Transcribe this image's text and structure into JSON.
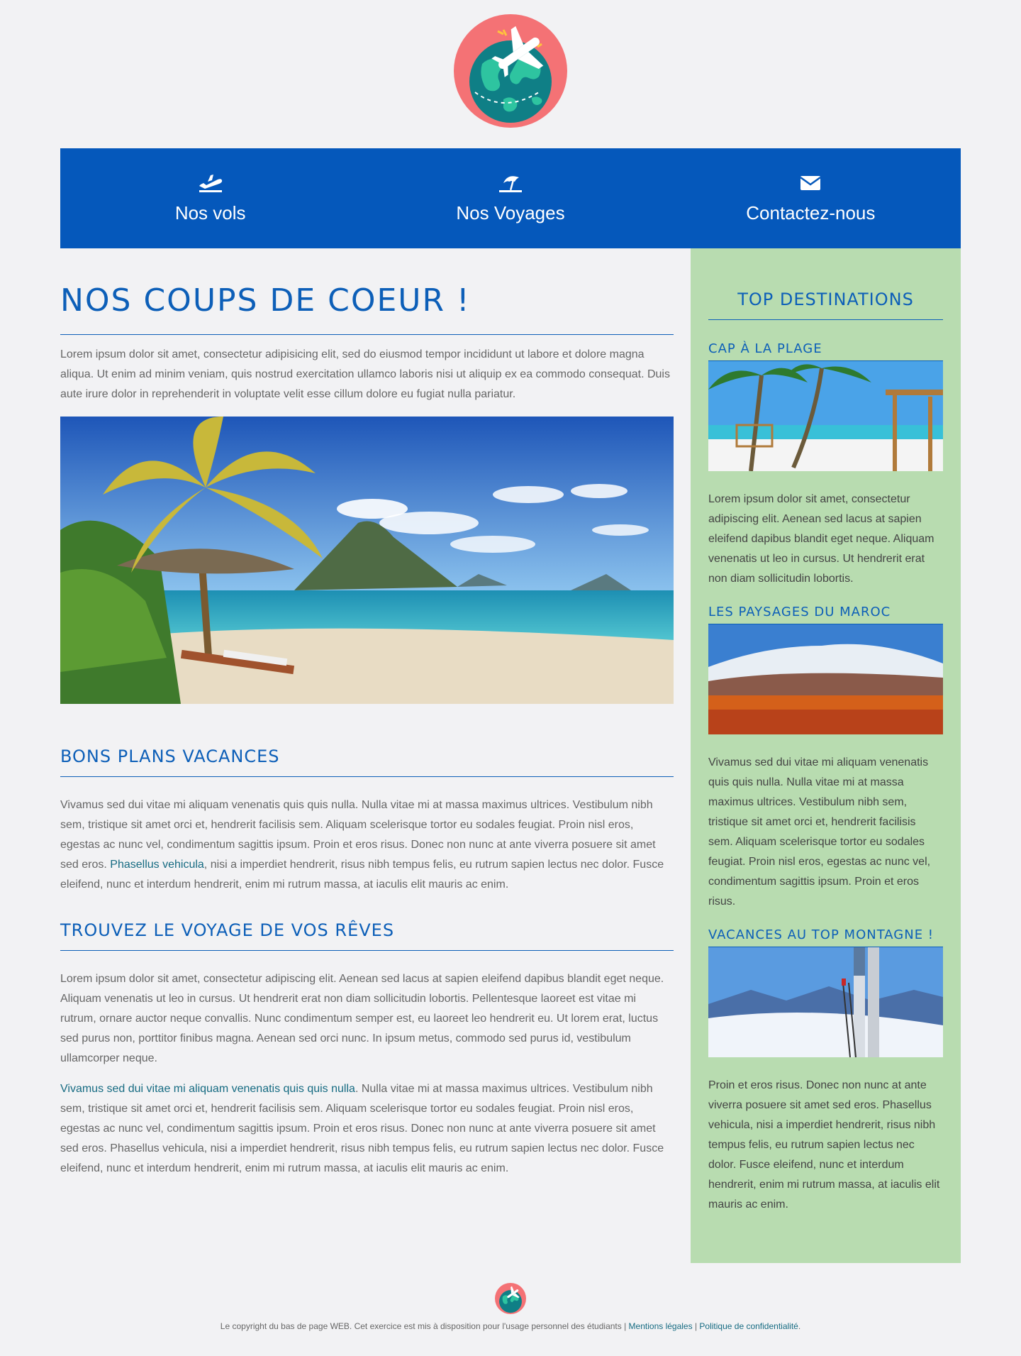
{
  "brand": {
    "logo_icon": "globe-airplane-logo"
  },
  "nav": {
    "items": [
      {
        "label": "Nos vols",
        "icon": "plane-departure-icon"
      },
      {
        "label": "Nos Voyages",
        "icon": "beach-umbrella-icon"
      },
      {
        "label": "Contactez-nous",
        "icon": "envelope-icon"
      }
    ]
  },
  "main": {
    "title": "Nos coups de coeur !",
    "intro": "Lorem ipsum dolor sit amet, consectetur adipisicing elit, sed do eiusmod tempor incididunt ut labore et dolore magna aliqua. Ut enim ad minim veniam, quis nostrud exercitation ullamco laboris nisi ut aliquip ex ea commodo consequat. Duis aute irure dolor in reprehenderit in voluptate velit esse cillum dolore eu fugiat nulla pariatur.",
    "section1": {
      "title": "Bons plans vacances",
      "text_before": "Vivamus sed dui vitae mi aliquam venenatis quis quis nulla. Nulla vitae mi at massa maximus ultrices. Vestibulum nibh sem, tristique sit amet orci et, hendrerit facilisis sem. Aliquam scelerisque tortor eu sodales feugiat. Proin nisl eros, egestas ac nunc vel, condimentum sagittis ipsum. Proin et eros risus. Donec non nunc at ante viverra posuere sit amet sed eros. ",
      "link": "Phasellus vehicula",
      "text_after": ", nisi a imperdiet hendrerit, risus nibh tempus felis, eu rutrum sapien lectus nec dolor. Fusce eleifend, nunc et interdum hendrerit, enim mi rutrum massa, at iaculis elit mauris ac enim."
    },
    "section2": {
      "title": "Trouvez le voyage de vos rêves",
      "para1": "Lorem ipsum dolor sit amet, consectetur adipiscing elit. Aenean sed lacus at sapien eleifend dapibus blandit eget neque. Aliquam venenatis ut leo in cursus. Ut hendrerit erat non diam sollicitudin lobortis. Pellentesque laoreet est vitae mi rutrum, ornare auctor neque convallis. Nunc condimentum semper est, eu laoreet leo hendrerit eu. Ut lorem erat, luctus sed purus non, porttitor finibus magna. Aenean sed orci nunc. In ipsum metus, commodo sed purus id, vestibulum ullamcorper neque.",
      "para2_link": "Vivamus sed dui vitae mi aliquam venenatis quis quis nulla",
      "para2_text": ". Nulla vitae mi at massa maximus ultrices. Vestibulum nibh sem, tristique sit amet orci et, hendrerit facilisis sem. Aliquam scelerisque tortor eu sodales feugiat. Proin nisl eros, egestas ac nunc vel, condimentum sagittis ipsum. Proin et eros risus. Donec non nunc at ante viverra posuere sit amet sed eros. Phasellus vehicula, nisi a imperdiet hendrerit, risus nibh tempus felis, eu rutrum sapien lectus nec dolor. Fusce eleifend, nunc et interdum hendrerit, enim mi rutrum massa, at iaculis elit mauris ac enim."
    }
  },
  "sidebar": {
    "title": "Top destinations",
    "items": [
      {
        "title": "Cap à la plage",
        "text": "Lorem ipsum dolor sit amet, consectetur adipiscing elit. Aenean sed lacus at sapien eleifend dapibus blandit eget neque. Aliquam venenatis ut leo in cursus. Ut hendrerit erat non diam sollicitudin lobortis."
      },
      {
        "title": "Les paysages du Maroc",
        "text": "Vivamus sed dui vitae mi aliquam venenatis quis quis nulla. Nulla vitae mi at massa maximus ultrices. Vestibulum nibh sem, tristique sit amet orci et, hendrerit facilisis sem. Aliquam scelerisque tortor eu sodales feugiat. Proin nisl eros, egestas ac nunc vel, condimentum sagittis ipsum. Proin et eros risus."
      },
      {
        "title": "Vacances au top montagne !",
        "text": "Proin et eros risus. Donec non nunc at ante viverra posuere sit amet sed eros. Phasellus vehicula, nisi a imperdiet hendrerit, risus nibh tempus felis, eu rutrum sapien lectus nec dolor. Fusce eleifend, nunc et interdum hendrerit, enim mi rutrum massa, at iaculis elit mauris ac enim."
      }
    ]
  },
  "footer": {
    "copyright": "Le copyright du bas de page WEB. Cet exercice est mis à disposition pour l'usage personnel des étudiants | ",
    "legal_link": "Mentions légales",
    "separator": " | ",
    "privacy_link": "Politique de confidentialité",
    "end": "."
  },
  "colors": {
    "nav_bg": "#0558bb",
    "heading": "#0d5fb8",
    "sidebar_bg": "#b8dcb0",
    "link": "#166b82",
    "logo_circle": "#f47275"
  }
}
